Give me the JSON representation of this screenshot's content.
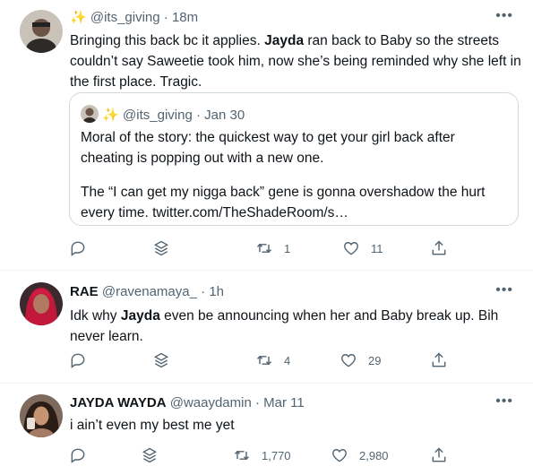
{
  "tweets": [
    {
      "sparkle": "✨",
      "name": "",
      "handle": "@its_giving",
      "dot": "·",
      "time": "18m",
      "more": "•••",
      "text_parts": [
        "Bringing this back bc it applies. ",
        "Jayda",
        " ran back to Baby so the streets couldn’t say Saweetie took him, now she’s being reminded why she left in the first place. Tragic."
      ],
      "quote": {
        "sparkle": "✨",
        "handle": "@its_giving",
        "dot": "·",
        "time": "Jan 30",
        "line1": "Moral of the story: the quickest way to get your girl back after cheating is popping out with a new one.",
        "line2": "The “I can get my nigga back” gene is gonna overshadow the hurt every time. twitter.com/TheShadeRoom/s…"
      },
      "retweets": "1",
      "likes": "11"
    },
    {
      "name": "RAE",
      "handle": "@ravenamaya_",
      "dot": "·",
      "time": "1h",
      "more": "•••",
      "text_parts": [
        "Idk why ",
        "Jayda",
        " even be announcing when her and Baby break up. Bih never learn."
      ],
      "retweets": "4",
      "likes": "29"
    },
    {
      "name": "JAYDA WAYDA",
      "handle": "@waaydamin",
      "dot": "·",
      "time": "Mar 11",
      "more": "•••",
      "text": "i ain’t even my best me yet",
      "retweets": "1,770",
      "likes": "2,980"
    }
  ],
  "icons": {
    "reply": "reply-icon",
    "stack": "stack-icon",
    "retweet": "retweet-icon",
    "like": "heart-icon",
    "share": "share-icon"
  },
  "colors": {
    "text": "#0f1419",
    "secondary": "#536471",
    "border": "#cfd9de",
    "divider": "#eff3f4",
    "sparkle": "#f4b400"
  }
}
